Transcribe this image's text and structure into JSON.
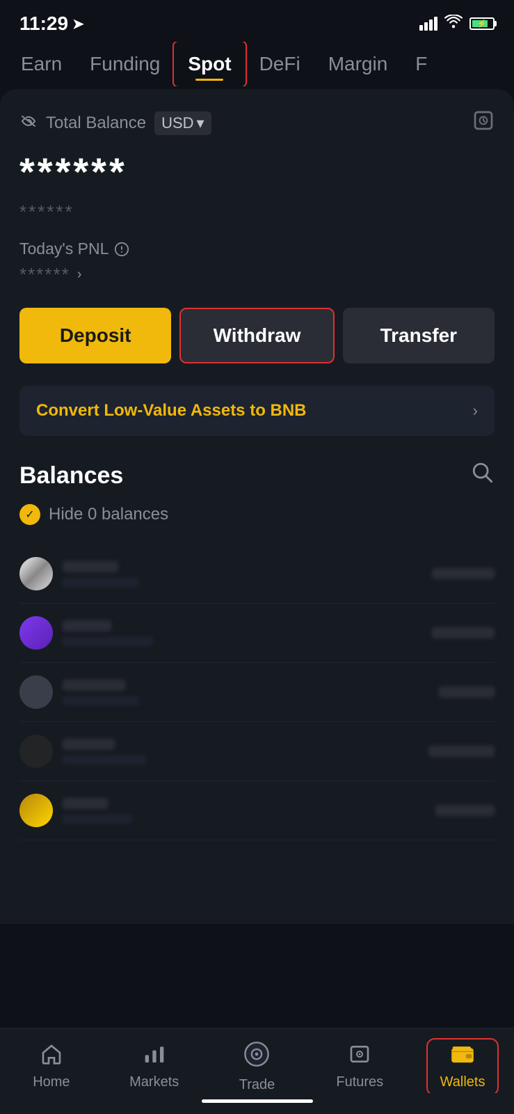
{
  "statusBar": {
    "time": "11:29",
    "locationArrow": "➤"
  },
  "tabs": [
    {
      "id": "earn",
      "label": "Earn",
      "active": false
    },
    {
      "id": "funding",
      "label": "Funding",
      "active": false
    },
    {
      "id": "spot",
      "label": "Spot",
      "active": true
    },
    {
      "id": "defi",
      "label": "DeFi",
      "active": false
    },
    {
      "id": "margin",
      "label": "Margin",
      "active": false
    },
    {
      "id": "f",
      "label": "F",
      "active": false
    }
  ],
  "balance": {
    "label": "Total Balance",
    "currency": "USD",
    "currencyArrow": "▾",
    "hiddenAmount": "******",
    "hiddenSub": "******",
    "pnlLabel": "Today's PNL",
    "pnlHidden": "******"
  },
  "actions": {
    "deposit": "Deposit",
    "withdraw": "Withdraw",
    "transfer": "Transfer"
  },
  "convertBanner": {
    "text": "Convert Low-Value Assets to BNB",
    "arrow": "›"
  },
  "balancesSection": {
    "title": "Balances",
    "hideZeroLabel": "Hide 0 balances"
  },
  "assets": [
    {
      "id": 1,
      "iconType": "btc",
      "hasData": false
    },
    {
      "id": 2,
      "iconType": "purple",
      "hasData": false
    },
    {
      "id": 3,
      "iconType": "gray",
      "hasData": false
    },
    {
      "id": 4,
      "iconType": "dark",
      "hasData": false
    },
    {
      "id": 5,
      "iconType": "gold",
      "hasData": false
    }
  ],
  "bottomNav": [
    {
      "id": "home",
      "label": "Home",
      "icon": "⌂",
      "active": false
    },
    {
      "id": "markets",
      "label": "Markets",
      "icon": "⏸",
      "active": false
    },
    {
      "id": "trade",
      "label": "Trade",
      "icon": "◎",
      "active": false
    },
    {
      "id": "futures",
      "label": "Futures",
      "icon": "⊡",
      "active": false
    },
    {
      "id": "wallets",
      "label": "Wallets",
      "icon": "▪",
      "active": true
    }
  ]
}
